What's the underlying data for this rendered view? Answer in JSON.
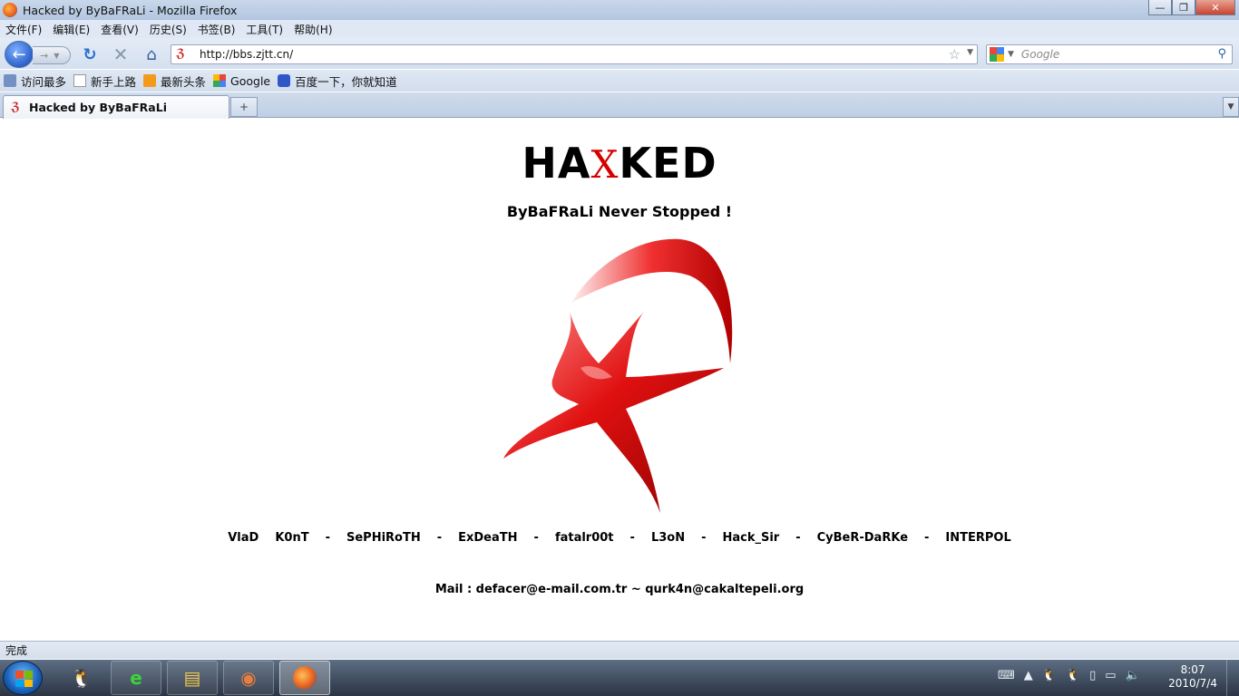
{
  "window": {
    "title": "Hacked by ByBaFRaLi - Mozilla Firefox",
    "controls": {
      "minimize": "—",
      "maximize": "❐",
      "close": "✕"
    }
  },
  "menu": [
    "文件(F)",
    "编辑(E)",
    "查看(V)",
    "历史(S)",
    "书签(B)",
    "工具(T)",
    "帮助(H)"
  ],
  "nav": {
    "url": "http://bbs.zjtt.cn/",
    "search_placeholder": "Google",
    "site_icon_glyph": "ℨ"
  },
  "bookmarks": [
    {
      "label": "访问最多",
      "icon": "most-visited-icon"
    },
    {
      "label": "新手上路",
      "icon": "page-icon"
    },
    {
      "label": "最新头条",
      "icon": "rss-icon"
    },
    {
      "label": "Google",
      "icon": "google-icon"
    },
    {
      "label": "百度一下，你就知道",
      "icon": "baidu-paw-icon"
    }
  ],
  "tabs": [
    {
      "label": "Hacked by ByBaFRaLi",
      "active": true
    }
  ],
  "page": {
    "title_pre": "HA",
    "title_x": "X",
    "title_post": "KED",
    "subtitle": "ByBaFRaLi Never Stopped !",
    "crew": [
      "VlaD",
      "K0nT",
      "-",
      "SePHiRoTH",
      "-",
      "ExDeaTH",
      "-",
      "fatalr00t",
      "-",
      "L3oN",
      "-",
      "Hack_Sir",
      "-",
      "CyBeR-DaRKe",
      "-",
      "INTERPOL"
    ],
    "mail": "Mail : defacer@e-mail.com.tr ~ qurk4n@cakaltepeli.org",
    "accent_color": "#d40000"
  },
  "status": {
    "text": "完成"
  },
  "taskbar": {
    "clock_time": "8:07",
    "clock_date": "2010/7/4",
    "apps": [
      "qq",
      "internet-explorer",
      "windows-explorer",
      "paint",
      "firefox"
    ]
  }
}
